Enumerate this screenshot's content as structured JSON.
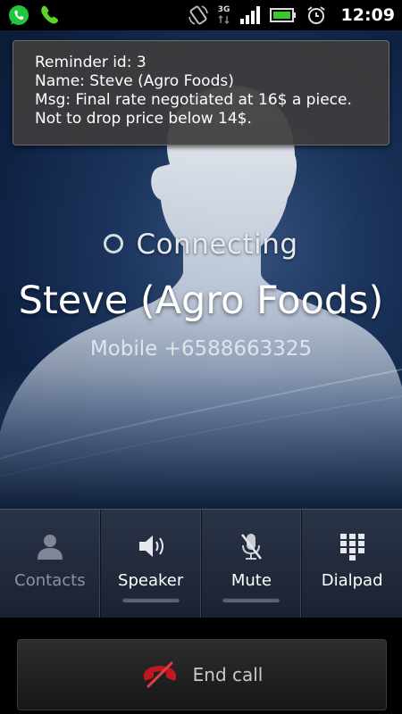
{
  "status_bar": {
    "time": "12:09",
    "network": "3G",
    "icons": [
      "whatsapp-icon",
      "phone-icon",
      "rotate-icon",
      "network-3g-icon",
      "signal-icon",
      "battery-icon",
      "alarm-icon"
    ]
  },
  "reminder": {
    "line1": "Reminder id: 3",
    "line2": "Name: Steve (Agro Foods)",
    "line3": "Msg:  Final rate negotiated at 16$ a piece.",
    "line4": "Not to drop price below 14$."
  },
  "call": {
    "status": "Connecting",
    "caller_name": "Steve (Agro Foods)",
    "caller_number": "Mobile +6588663325"
  },
  "actions": [
    {
      "label": "Contacts",
      "icon": "contacts-icon",
      "enabled": false
    },
    {
      "label": "Speaker",
      "icon": "speaker-icon",
      "enabled": true
    },
    {
      "label": "Mute",
      "icon": "mute-icon",
      "enabled": true
    },
    {
      "label": "Dialpad",
      "icon": "dialpad-icon",
      "enabled": true
    }
  ],
  "end_call": {
    "label": "End call",
    "icon": "end-call-icon"
  },
  "colors": {
    "end_call_red": "#c0181e",
    "whatsapp_green": "#25c43f",
    "battery_green": "#36c82c"
  }
}
